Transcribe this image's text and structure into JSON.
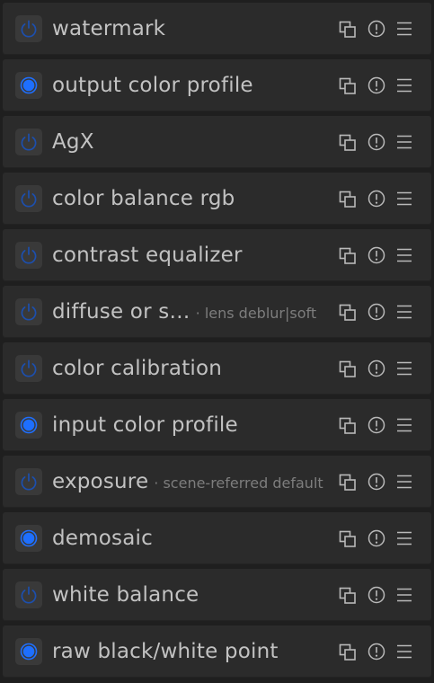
{
  "modules": [
    {
      "name": "watermark",
      "label": "",
      "enabled": false
    },
    {
      "name": "output color profile",
      "label": "",
      "enabled": true
    },
    {
      "name": "AgX",
      "label": "",
      "enabled": false
    },
    {
      "name": "color balance rgb",
      "label": "",
      "enabled": false
    },
    {
      "name": "contrast equalizer",
      "label": "",
      "enabled": false
    },
    {
      "name": "diffuse or s…",
      "label": "· lens deblur|soft",
      "enabled": false
    },
    {
      "name": "color calibration",
      "label": "",
      "enabled": false
    },
    {
      "name": "input color profile",
      "label": "",
      "enabled": true
    },
    {
      "name": "exposure",
      "label": "· scene-referred default",
      "enabled": false
    },
    {
      "name": "demosaic",
      "label": "",
      "enabled": true
    },
    {
      "name": "white balance",
      "label": "",
      "enabled": false
    },
    {
      "name": "raw black/white point",
      "label": "",
      "enabled": true
    }
  ],
  "icons": {
    "power": "power-icon",
    "copy": "multi-instance-icon",
    "info": "reset-icon",
    "menu": "presets-menu-icon"
  },
  "colors": {
    "enabled": "#1e6fff",
    "disabled": "#1c4fae",
    "text": "#c2c2c2",
    "label": "#7d7d7d",
    "row_bg": "#2b2b2b",
    "page_bg": "#1f1f1f"
  }
}
